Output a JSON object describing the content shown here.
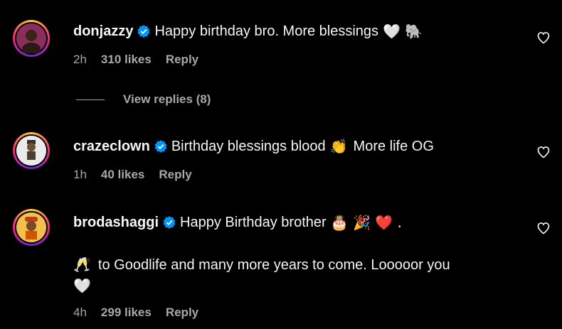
{
  "comments": [
    {
      "username": "donjazzy",
      "text": "Happy birthday bro. More blessings",
      "emoji": "🤍 🐘",
      "time": "2h",
      "likes": "310 likes",
      "reply": "Reply",
      "view_replies": "View replies (8)",
      "avatar_icon": "person-avatar"
    },
    {
      "username": "crazeclown",
      "text": "Birthday blessings blood",
      "emoji": "👏",
      "text_after": "More life OG",
      "time": "1h",
      "likes": "40 likes",
      "reply": "Reply",
      "avatar_icon": "cartoon-avatar"
    },
    {
      "username": "brodashaggi",
      "text": "Happy Birthday brother",
      "emoji": "🎂 🎉 ❤️ .",
      "line2_emoji": "🥂",
      "line2_text": "to Goodlife and many more years to come. Looooor you",
      "line3_emoji": "🤍",
      "time": "4h",
      "likes": "299 likes",
      "reply": "Reply",
      "avatar_icon": "cartoon-avatar"
    }
  ],
  "colors": {
    "background": "#000000",
    "text": "#f5f5f5",
    "muted": "#a8a8a8",
    "verified": "#0095f6"
  }
}
